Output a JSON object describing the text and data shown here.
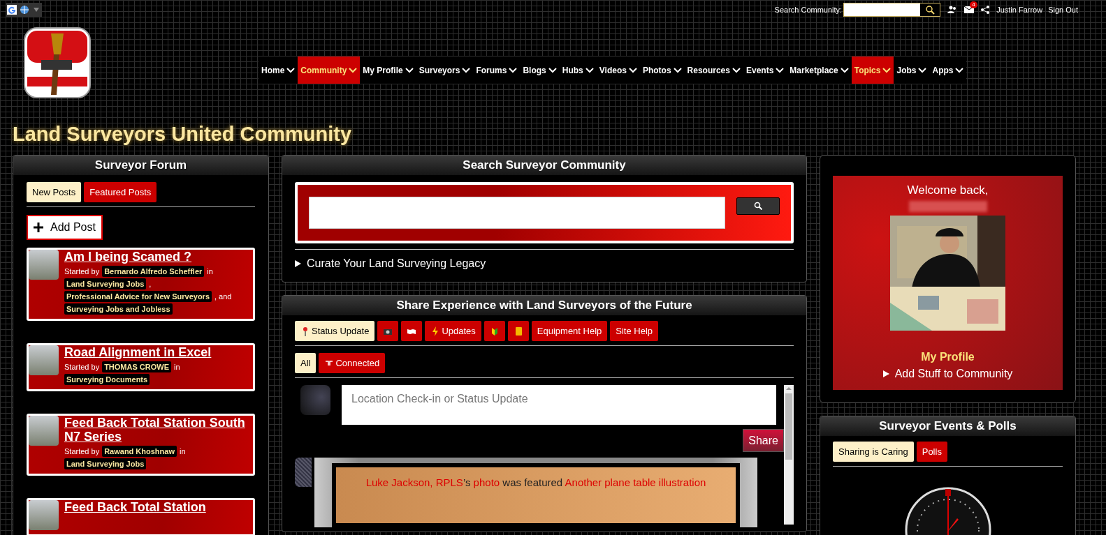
{
  "top_bar": {
    "search_label": "Search Community:",
    "mail_count": "4",
    "user": "Justin Farrow",
    "sign_out": "Sign Out"
  },
  "nav": [
    {
      "label": "Home",
      "selected": false
    },
    {
      "label": "Community",
      "selected": true
    },
    {
      "label": "My Profile",
      "selected": false
    },
    {
      "label": "Surveyors",
      "selected": false
    },
    {
      "label": "Forums",
      "selected": false
    },
    {
      "label": "Blogs",
      "selected": false
    },
    {
      "label": "Hubs",
      "selected": false
    },
    {
      "label": "Videos",
      "selected": false
    },
    {
      "label": "Photos",
      "selected": false
    },
    {
      "label": "Resources",
      "selected": false
    },
    {
      "label": "Events",
      "selected": false
    },
    {
      "label": "Marketplace",
      "selected": false
    },
    {
      "label": "Topics",
      "selected": true
    },
    {
      "label": "Jobs",
      "selected": false
    },
    {
      "label": "Apps",
      "selected": false
    }
  ],
  "page_title": "Land Surveyors United Community",
  "forum": {
    "heading": "Surveyor Forum",
    "tabs": [
      {
        "label": "New Posts",
        "selected": true
      },
      {
        "label": "Featured Posts",
        "selected": false
      }
    ],
    "add_post": "Add Post",
    "posts": [
      {
        "title": "Am I being Scamed ?",
        "meta": [
          {
            "kind": "text",
            "text": "Started by"
          },
          {
            "kind": "tag",
            "text": "Bernardo Alfredo Scheffler"
          },
          {
            "kind": "text",
            "text": "in"
          },
          {
            "kind": "tag",
            "text": "Land Surveying Jobs"
          },
          {
            "kind": "text",
            "text": ","
          },
          {
            "kind": "tag",
            "text": "Professional Advice for New Surveyors"
          },
          {
            "kind": "text",
            "text": ", and"
          },
          {
            "kind": "tag",
            "text": "Surveying Jobs and Jobless"
          }
        ]
      },
      {
        "title": "Road Alignment in Excel",
        "meta": [
          {
            "kind": "text",
            "text": "Started by"
          },
          {
            "kind": "tag",
            "text": "THOMAS CROWE"
          },
          {
            "kind": "text",
            "text": "in"
          },
          {
            "kind": "tag",
            "text": "Surveying Documents"
          }
        ]
      },
      {
        "title": "Feed Back Total Station South N7 Series",
        "meta": [
          {
            "kind": "text",
            "text": "Started by"
          },
          {
            "kind": "tag",
            "text": "Rawand Khoshnaw"
          },
          {
            "kind": "text",
            "text": "in"
          },
          {
            "kind": "tag",
            "text": "Land Surveying Jobs"
          }
        ]
      },
      {
        "title": "Feed Back Total Station"
      }
    ]
  },
  "search_panel": {
    "heading": "Search Surveyor Community",
    "legacy": "Curate Your Land Surveying Legacy"
  },
  "share_panel": {
    "heading": "Share Experience with Land Surveyors of the Future",
    "tabs": [
      {
        "label": "Status Update",
        "selected": true
      },
      {
        "selected": false
      },
      {
        "selected": false
      },
      {
        "label": "Updates",
        "selected": false
      },
      {
        "selected": false
      },
      {
        "selected": false
      },
      {
        "label": "Equipment Help",
        "selected": false
      },
      {
        "label": "Site Help",
        "selected": false
      }
    ],
    "filters": [
      {
        "label": "All",
        "selected": true
      },
      {
        "label": "Connected",
        "selected": false
      }
    ],
    "status_placeholder": "Location Check-in or Status Update",
    "share_button": "Share",
    "feed_item": [
      {
        "kind": "link",
        "text": "Luke Jackson, RPLS"
      },
      {
        "kind": "plain",
        "text": "’s "
      },
      {
        "kind": "link",
        "text": "photo"
      },
      {
        "kind": "plain",
        "text": " was featured "
      },
      {
        "kind": "link",
        "text": "Another plane table illustration"
      }
    ]
  },
  "welcome": {
    "greeting": "Welcome back,",
    "profile_link": "My Profile",
    "add_stuff": "Add Stuff to Community"
  },
  "events": {
    "heading": "Surveyor Events & Polls",
    "tabs": [
      {
        "label": "Sharing is Caring",
        "selected": true
      },
      {
        "label": "Polls",
        "selected": false
      }
    ]
  }
}
